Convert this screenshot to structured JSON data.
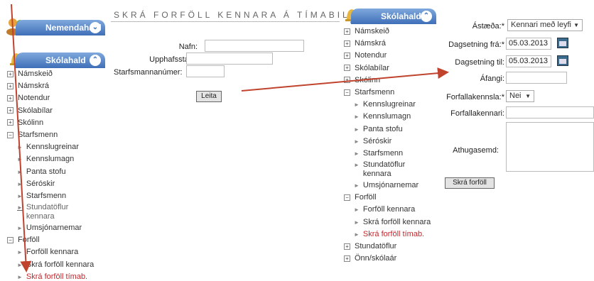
{
  "left_sidebar": {
    "nemendahald": "Nemendahald",
    "skolahald": "Skólahald",
    "items": [
      {
        "type": "group",
        "box": "+",
        "label": "Námskeið"
      },
      {
        "type": "group",
        "box": "+",
        "label": "Námskrá"
      },
      {
        "type": "group",
        "box": "+",
        "label": "Notendur"
      },
      {
        "type": "group",
        "box": "+",
        "label": "Skólabílar"
      },
      {
        "type": "group",
        "box": "+",
        "label": "Skólinn"
      },
      {
        "type": "group",
        "box": "−",
        "label": "Starfsmenn"
      },
      {
        "type": "sub",
        "label": "Kennslugreinar"
      },
      {
        "type": "sub",
        "label": "Kennslumagn"
      },
      {
        "type": "sub",
        "label": "Panta stofu"
      },
      {
        "type": "sub",
        "label": "Séróskir"
      },
      {
        "type": "sub",
        "label": "Starfsmenn"
      },
      {
        "type": "sub-link",
        "label": "Stundatöflur kennara"
      },
      {
        "type": "sub",
        "label": "Umsjónarnemar"
      },
      {
        "type": "group",
        "box": "−",
        "label": "Forföll"
      },
      {
        "type": "sub",
        "label": "Forföll kennara"
      },
      {
        "type": "sub",
        "label": "Skrá forföll kennara"
      },
      {
        "type": "sub-active",
        "label": "Skrá forföll tímab."
      }
    ]
  },
  "search_form": {
    "title": "SKRÁ FORFÖLL KENNARA Á TÍMABILI",
    "name_label": "Nafn:",
    "initials_label": "Upphafsstafir:",
    "staff_number_label": "Starfsmannanúmer:",
    "search_button": "Leita"
  },
  "right_sidebar": {
    "skolahald": "Skólahald",
    "items": [
      {
        "type": "group",
        "box": "+",
        "label": "Námskeið"
      },
      {
        "type": "group",
        "box": "+",
        "label": "Námskrá"
      },
      {
        "type": "group",
        "box": "+",
        "label": "Notendur"
      },
      {
        "type": "group",
        "box": "+",
        "label": "Skólabílar"
      },
      {
        "type": "group",
        "box": "+",
        "label": "Skólinn"
      },
      {
        "type": "group",
        "box": "−",
        "label": "Starfsmenn"
      },
      {
        "type": "sub",
        "label": "Kennslugreinar"
      },
      {
        "type": "sub",
        "label": "Kennslumagn"
      },
      {
        "type": "sub",
        "label": "Panta stofu"
      },
      {
        "type": "sub",
        "label": "Séróskir"
      },
      {
        "type": "sub",
        "label": "Starfsmenn"
      },
      {
        "type": "sub-two",
        "label": "Stundatöflur kennara"
      },
      {
        "type": "sub",
        "label": "Umsjónarnemar"
      },
      {
        "type": "group",
        "box": "−",
        "label": "Forföll"
      },
      {
        "type": "sub",
        "label": "Forföll kennara"
      },
      {
        "type": "sub",
        "label": "Skrá forföll kennara"
      },
      {
        "type": "sub-active",
        "label": "Skrá forföll tímab."
      },
      {
        "type": "group",
        "box": "+",
        "label": "Stundatöflur"
      },
      {
        "type": "group",
        "box": "+",
        "label": "Önn/skólaár"
      }
    ]
  },
  "absence_form": {
    "reason_label": "Ástæða:*",
    "reason_value": "Kennari með leyfi",
    "date_from_label": "Dagsetning frá:*",
    "date_from_value": "05.03.2013",
    "date_to_label": "Dagsetning til:",
    "date_to_value": "05.03.2013",
    "course_label": "Áfangi:",
    "absence_teaching_label": "Forfallakennsla:*",
    "absence_teaching_value": "Nei",
    "substitute_label": "Forfallakennari:",
    "note_label": "Athugasemd:",
    "submit_button": "Skrá forföll"
  },
  "colors": {
    "panel_header": "#3f6fb8",
    "active_item": "#c0282d",
    "annotation_arrow": "#c0432d"
  }
}
